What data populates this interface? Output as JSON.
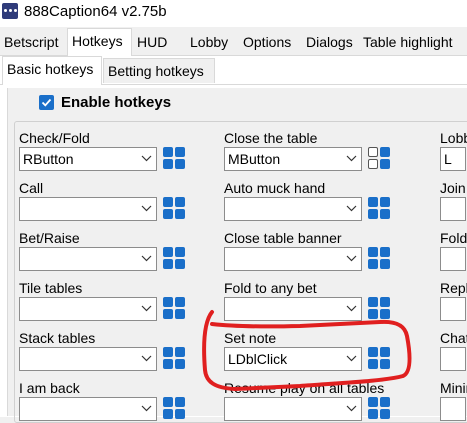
{
  "window": {
    "title": "888Caption64 v2.75b"
  },
  "tabs": [
    "Betscript",
    "Hotkeys",
    "HUD",
    "Lobby",
    "Options",
    "Dialogs",
    "Table highlight"
  ],
  "selected_tab": "Hotkeys",
  "subtabs": [
    "Basic hotkeys",
    "Betting hotkeys"
  ],
  "selected_subtab": "Basic hotkeys",
  "enable_hotkeys": {
    "label": "Enable hotkeys",
    "checked": true
  },
  "hotkeys": {
    "col1": [
      {
        "label": "Check/Fold",
        "value": "RButton"
      },
      {
        "label": "Call",
        "value": ""
      },
      {
        "label": "Bet/Raise",
        "value": ""
      },
      {
        "label": "Tile tables",
        "value": ""
      },
      {
        "label": "Stack tables",
        "value": ""
      },
      {
        "label": "I am back",
        "value": ""
      }
    ],
    "col2": [
      {
        "label": "Close the table",
        "value": "MButton"
      },
      {
        "label": "Auto muck hand",
        "value": ""
      },
      {
        "label": "Close table banner",
        "value": ""
      },
      {
        "label": "Fold to any bet",
        "value": ""
      },
      {
        "label": "Set note",
        "value": "LDblClick"
      },
      {
        "label": "Resume play on all tables",
        "value": ""
      }
    ],
    "col3": [
      {
        "label": "Lobb",
        "value": "L"
      },
      {
        "label": "Join",
        "value": ""
      },
      {
        "label": "Fold",
        "value": ""
      },
      {
        "label": "Repl",
        "value": ""
      },
      {
        "label": "Chat",
        "value": ""
      },
      {
        "label": "Minir",
        "value": ""
      }
    ]
  },
  "colors": {
    "accent": "#1a6fc9",
    "annotation": "#e01f1f"
  }
}
